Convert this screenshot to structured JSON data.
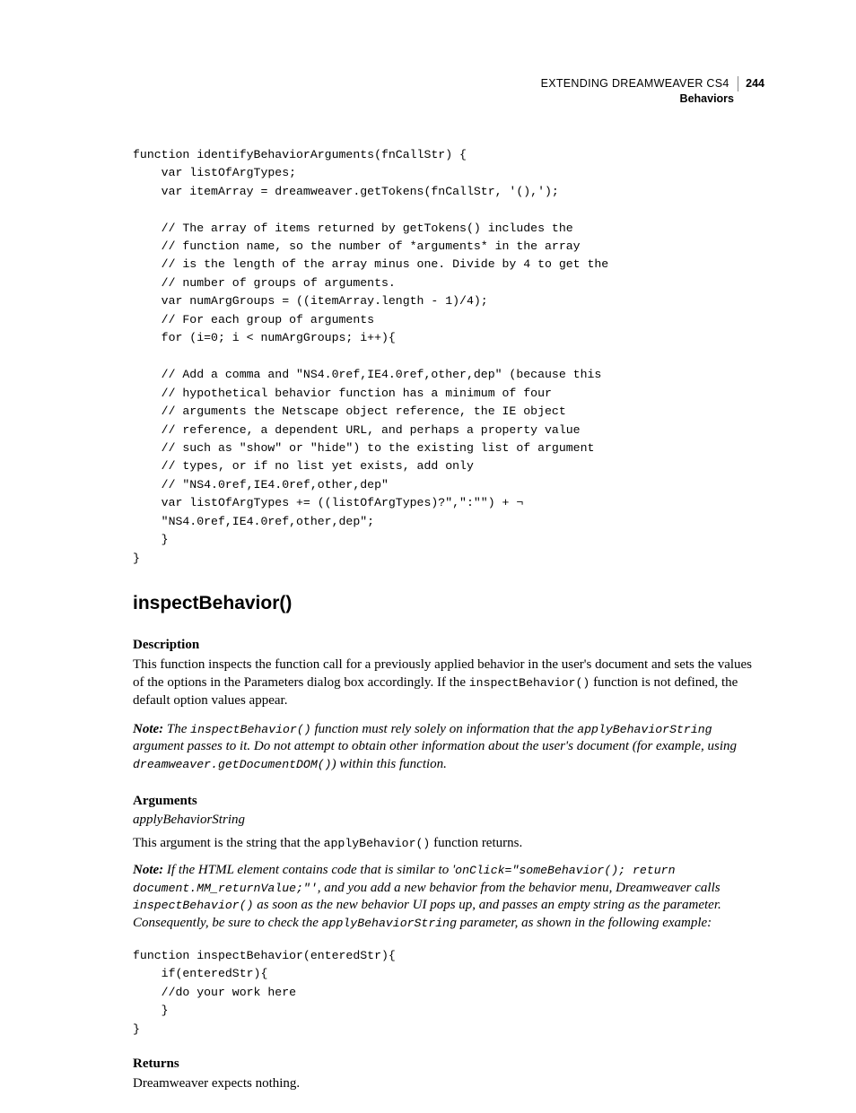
{
  "header": {
    "title_line": "EXTENDING DREAMWEAVER CS4",
    "page_number": "244",
    "section": "Behaviors"
  },
  "code_block_1": "function identifyBehaviorArguments(fnCallStr) {\n    var listOfArgTypes;\n    var itemArray = dreamweaver.getTokens(fnCallStr, '(),');\n\n    // The array of items returned by getTokens() includes the\n    // function name, so the number of *arguments* in the array\n    // is the length of the array minus one. Divide by 4 to get the\n    // number of groups of arguments.\n    var numArgGroups = ((itemArray.length - 1)/4);\n    // For each group of arguments\n    for (i=0; i < numArgGroups; i++){\n\n    // Add a comma and \"NS4.0ref,IE4.0ref,other,dep\" (because this\n    // hypothetical behavior function has a minimum of four\n    // arguments the Netscape object reference, the IE object\n    // reference, a dependent URL, and perhaps a property value\n    // such as \"show\" or \"hide\") to the existing list of argument\n    // types, or if no list yet exists, add only\n    // \"NS4.0ref,IE4.0ref,other,dep\"\n    var listOfArgTypes += ((listOfArgTypes)?\",\":\"\") + ¬\n    \"NS4.0ref,IE4.0ref,other,dep\";\n    }\n}",
  "heading": "inspectBehavior()",
  "description": {
    "label": "Description",
    "para_pre": "This function inspects the function call for a previously applied behavior in the user's document and sets the values of the options in the Parameters dialog box accordingly. If the ",
    "code1": "inspectBehavior()",
    "para_post": " function is not defined, the default option values appear.",
    "note_label": "Note:",
    "note_pre": " The ",
    "note_code1": "inspectBehavior()",
    "note_mid1": " function must rely solely on information that the ",
    "note_code2": "applyBehaviorString",
    "note_mid2": " argument passes to it. Do not attempt to obtain other information about the user's document (for example, using ",
    "note_code3": "dreamweaver.getDocumentDOM()",
    "note_end": ") within this function."
  },
  "arguments": {
    "label": "Arguments",
    "name": "applyBehaviorString",
    "para_pre": "This argument is the string that the ",
    "code1": "applyBehavior()",
    "para_post": " function returns.",
    "note_label": "Note:",
    "n_pre": " If the HTML element contains code that is similar to '",
    "n_code1": "onClick=\"someBehavior(); return document.MM_returnValue;\"'",
    "n_mid1": ", and you add a new behavior from the behavior menu, Dreamweaver calls ",
    "n_code2": "inspectBehavior()",
    "n_mid2": " as soon as the new behavior UI pops up, and passes an empty string as the parameter. Consequently, be sure to check the ",
    "n_code3": "applyBehaviorString",
    "n_end": " parameter, as shown in the following example:"
  },
  "code_block_2": "function inspectBehavior(enteredStr){\n    if(enteredStr){\n    //do your work here\n    }\n}",
  "returns": {
    "label": "Returns",
    "text": "Dreamweaver expects nothing."
  }
}
